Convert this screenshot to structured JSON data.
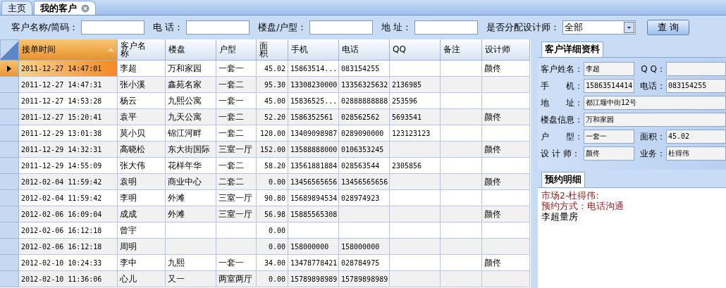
{
  "tabs": [
    {
      "label": "主页",
      "selected": false,
      "closable": false
    },
    {
      "label": "我的客户",
      "selected": true,
      "closable": true
    }
  ],
  "filters": [
    {
      "label": "客户名称/简码：",
      "kind": "text"
    },
    {
      "label": "电 话：",
      "kind": "text"
    },
    {
      "label": "楼盘/户型：",
      "kind": "text"
    },
    {
      "label": "地 址：",
      "kind": "text"
    },
    {
      "label": "是否分配设计师：",
      "kind": "select",
      "value": "全部"
    }
  ],
  "query_button": "查 询",
  "table": {
    "columns": [
      {
        "label": "接单时间",
        "sorted": true
      },
      {
        "label": "客户名称",
        "sorted": false
      },
      {
        "label": "楼盘",
        "sorted": false
      },
      {
        "label": "户型",
        "sorted": false
      },
      {
        "label": "面积",
        "sorted": false
      },
      {
        "label": "手机",
        "sorted": false
      },
      {
        "label": "电话",
        "sorted": false
      },
      {
        "label": "QQ",
        "sorted": false
      },
      {
        "label": "备注",
        "sorted": false
      },
      {
        "label": "设计师",
        "sorted": false
      }
    ],
    "rows": [
      {
        "selected": true,
        "cells": [
          "2011-12-27 14:47:01",
          "李超",
          "万和家园",
          "一套一",
          "45.02",
          "15863514...",
          "083154255",
          "",
          "",
          "颜佟"
        ]
      },
      {
        "selected": false,
        "cells": [
          "2011-12-27 14:47:31",
          "张小溪",
          "鑫苑名家",
          "一套二",
          "95.30",
          "13308230000",
          "13356325632",
          "2136985",
          "",
          ""
        ]
      },
      {
        "selected": false,
        "cells": [
          "2011-12-27 14:53:28",
          "杨云",
          "九熙公寓",
          "一套一",
          "45.00",
          "15836525...",
          "02888888888",
          "253596",
          "",
          ""
        ]
      },
      {
        "selected": false,
        "cells": [
          "2011-12-27 15:20:41",
          "袁平",
          "九天公寓",
          "一套二",
          "52.20",
          "1586352561",
          "028562562",
          "5693541",
          "",
          "颜佟"
        ]
      },
      {
        "selected": false,
        "cells": [
          "2011-12-29 13:01:38",
          "莫小贝",
          "锦江河畔",
          "一套二",
          "120.00",
          "13409098987",
          "0289090000",
          "123123123",
          "",
          ""
        ]
      },
      {
        "selected": false,
        "cells": [
          "2011-12-29 14:32:31",
          "高晓松",
          "东大街国际",
          "三室一厅",
          "152.00",
          "13588888000",
          "0106353245",
          "",
          "",
          "颜佟"
        ]
      },
      {
        "selected": false,
        "cells": [
          "2011-12-29 14:55:09",
          "张大伟",
          "花样年华",
          "一套二",
          "58.20",
          "13561881884",
          "028563544",
          "2305856",
          "",
          ""
        ]
      },
      {
        "selected": false,
        "cells": [
          "2012-02-04 11:59:42",
          "袁明",
          "商业中心",
          "二套二",
          "0.00",
          "13456565656",
          "13456565656",
          "",
          "",
          "颜佟"
        ]
      },
      {
        "selected": false,
        "cells": [
          "2012-02-04 11:59:42",
          "李明",
          "外滩",
          "三室一厅",
          "90.80",
          "15689894534",
          "028974923",
          "",
          "",
          ""
        ]
      },
      {
        "selected": false,
        "cells": [
          "2012-02-06 16:09:04",
          "成成",
          "外滩",
          "三室一厅",
          "56.98",
          "15885565308",
          "",
          "",
          "",
          "颜佟"
        ]
      },
      {
        "selected": false,
        "cells": [
          "2012-02-06 16:12:18",
          "曾宇",
          "",
          "",
          "0.00",
          "",
          "",
          "",
          "",
          ""
        ]
      },
      {
        "selected": false,
        "cells": [
          "2012-02-06 16:12:18",
          "周明",
          "",
          "",
          "0.00",
          "158000000",
          "158000000",
          "",
          "",
          ""
        ]
      },
      {
        "selected": false,
        "cells": [
          "2012-02-10 10:24:33",
          "李中",
          "九熙",
          "一套一",
          "34.00",
          "13478778421",
          "028784975",
          "",
          "",
          "颜佟"
        ]
      },
      {
        "selected": false,
        "cells": [
          "2012-02-10 11:36:06",
          "心儿",
          "又一",
          "两室两厅",
          "0.00",
          "15789898989",
          "15789898989",
          "",
          "",
          ""
        ]
      }
    ]
  },
  "detail": {
    "title": "客户详细资料",
    "rows": [
      [
        {
          "label": "客户姓名：",
          "value": "李超"
        },
        {
          "label": "Q Q："
        }
      ],
      [
        {
          "label": "手　　机：",
          "value": "15863514414"
        },
        {
          "label": "电话：",
          "value": "083154255"
        }
      ],
      [
        {
          "label": "地　　址：",
          "value": "都江堰中街12号"
        }
      ],
      [
        {
          "label": "楼盘信息：",
          "value": "万和家园"
        }
      ],
      [
        {
          "label": "户　　型：",
          "value": "一套一"
        },
        {
          "label": "面积：",
          "value": "45.02"
        }
      ],
      [
        {
          "label": "设 计 师：",
          "value": "颜佟"
        },
        {
          "label": "业务：",
          "value": "杜得伟"
        }
      ]
    ]
  },
  "appointment": {
    "title": "预约明细",
    "lines": [
      {
        "text": "市场2-杜得伟:",
        "kind": "header"
      },
      {
        "text": "预约方式：电话沟通",
        "kind": "header"
      },
      {
        "text": "李超量房",
        "kind": "body"
      }
    ]
  }
}
